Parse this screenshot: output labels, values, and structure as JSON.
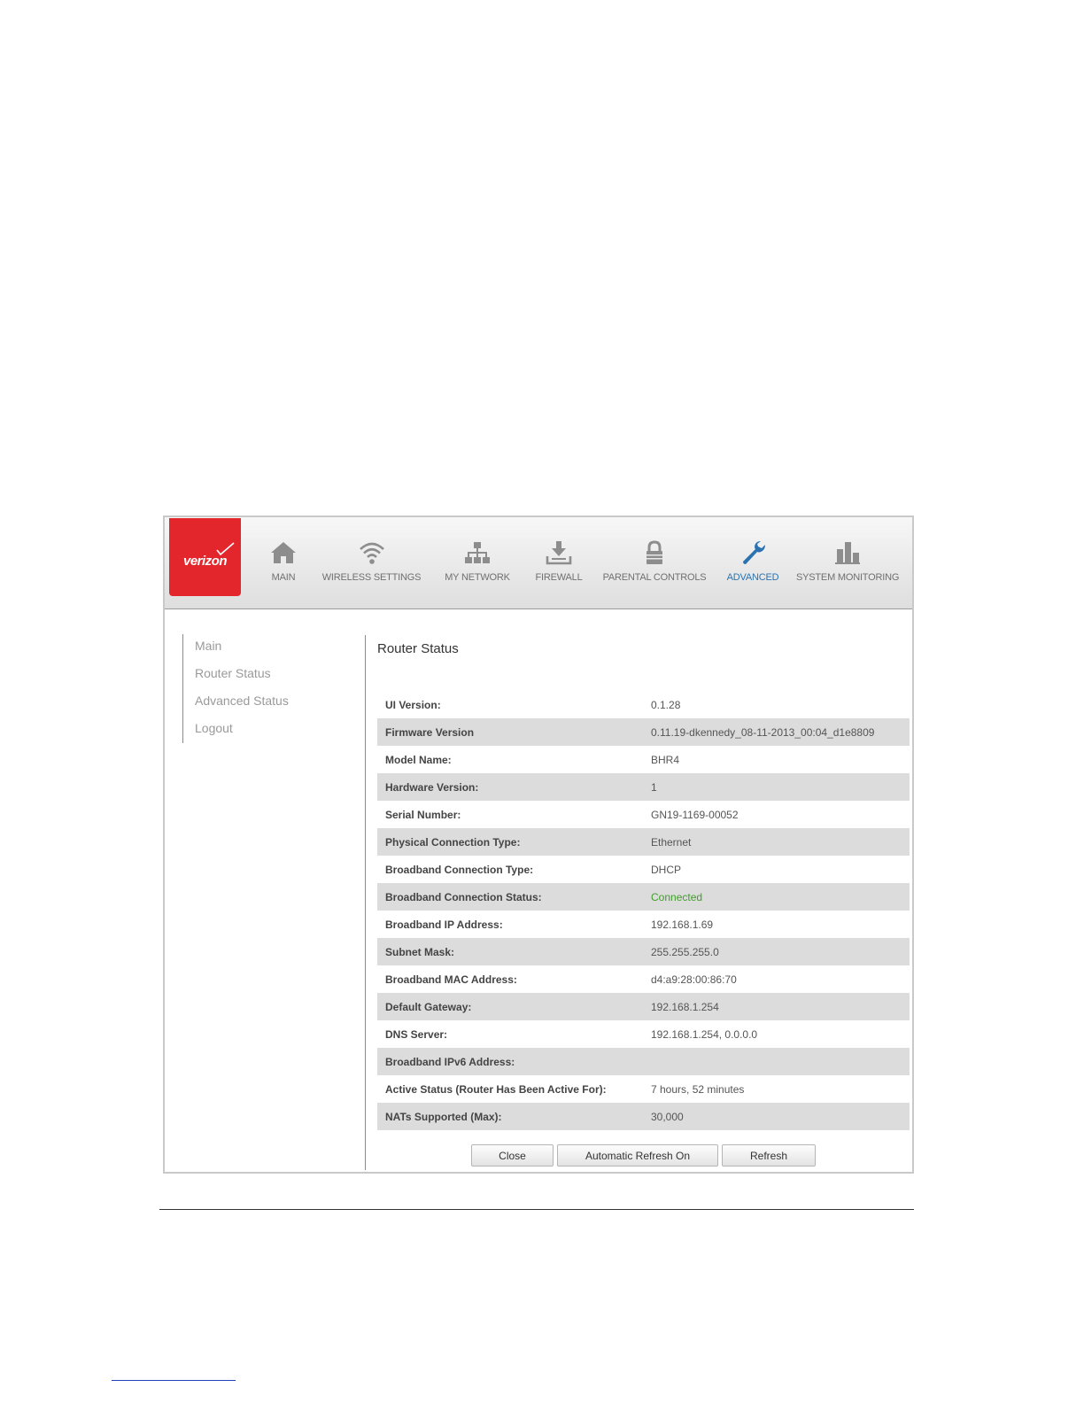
{
  "brand": {
    "logo_text": "verizon",
    "color": "#e3262c"
  },
  "nav": {
    "items": [
      {
        "label": "MAIN",
        "icon": "home-icon",
        "active": false
      },
      {
        "label": "WIRELESS SETTINGS",
        "icon": "wifi-icon",
        "active": false
      },
      {
        "label": "MY NETWORK",
        "icon": "network-icon",
        "active": false
      },
      {
        "label": "FIREWALL",
        "icon": "firewall-icon",
        "active": false
      },
      {
        "label": "PARENTAL CONTROLS",
        "icon": "lock-icon",
        "active": false
      },
      {
        "label": "ADVANCED",
        "icon": "wrench-icon",
        "active": true
      },
      {
        "label": "SYSTEM MONITORING",
        "icon": "bar-chart-icon",
        "active": false
      }
    ],
    "active_color": "#2b73b0"
  },
  "sidebar": {
    "items": [
      {
        "label": "Main"
      },
      {
        "label": "Router Status"
      },
      {
        "label": "Advanced Status"
      },
      {
        "label": "Logout"
      }
    ]
  },
  "page": {
    "title": "Router Status"
  },
  "status": {
    "rows": [
      {
        "label": "UI Version:",
        "value": "0.1.28"
      },
      {
        "label": "Firmware Version",
        "value": "0.11.19-dkennedy_08-11-2013_00:04_d1e8809"
      },
      {
        "label": "Model Name:",
        "value": "BHR4"
      },
      {
        "label": "Hardware Version:",
        "value": "1"
      },
      {
        "label": "Serial Number:",
        "value": "GN19-1169-00052"
      },
      {
        "label": "Physical Connection Type:",
        "value": "Ethernet"
      },
      {
        "label": "Broadband Connection Type:",
        "value": "DHCP"
      },
      {
        "label": "Broadband Connection Status:",
        "value": "Connected"
      },
      {
        "label": "Broadband IP Address:",
        "value": "192.168.1.69"
      },
      {
        "label": "Subnet Mask:",
        "value": "255.255.255.0"
      },
      {
        "label": "Broadband MAC Address:",
        "value": "d4:a9:28:00:86:70"
      },
      {
        "label": "Default Gateway:",
        "value": "192.168.1.254"
      },
      {
        "label": "DNS Server:",
        "value": "192.168.1.254, 0.0.0.0"
      },
      {
        "label": "Broadband IPv6 Address:",
        "value": ""
      },
      {
        "label": "Active Status (Router Has Been Active For):",
        "value": "7 hours, 52 minutes"
      },
      {
        "label": "NATs Supported (Max):",
        "value": "30,000"
      }
    ],
    "connected_color": "#3f9f2a"
  },
  "buttons": {
    "close": "Close",
    "auto_refresh": "Automatic Refresh On",
    "refresh": "Refresh"
  }
}
